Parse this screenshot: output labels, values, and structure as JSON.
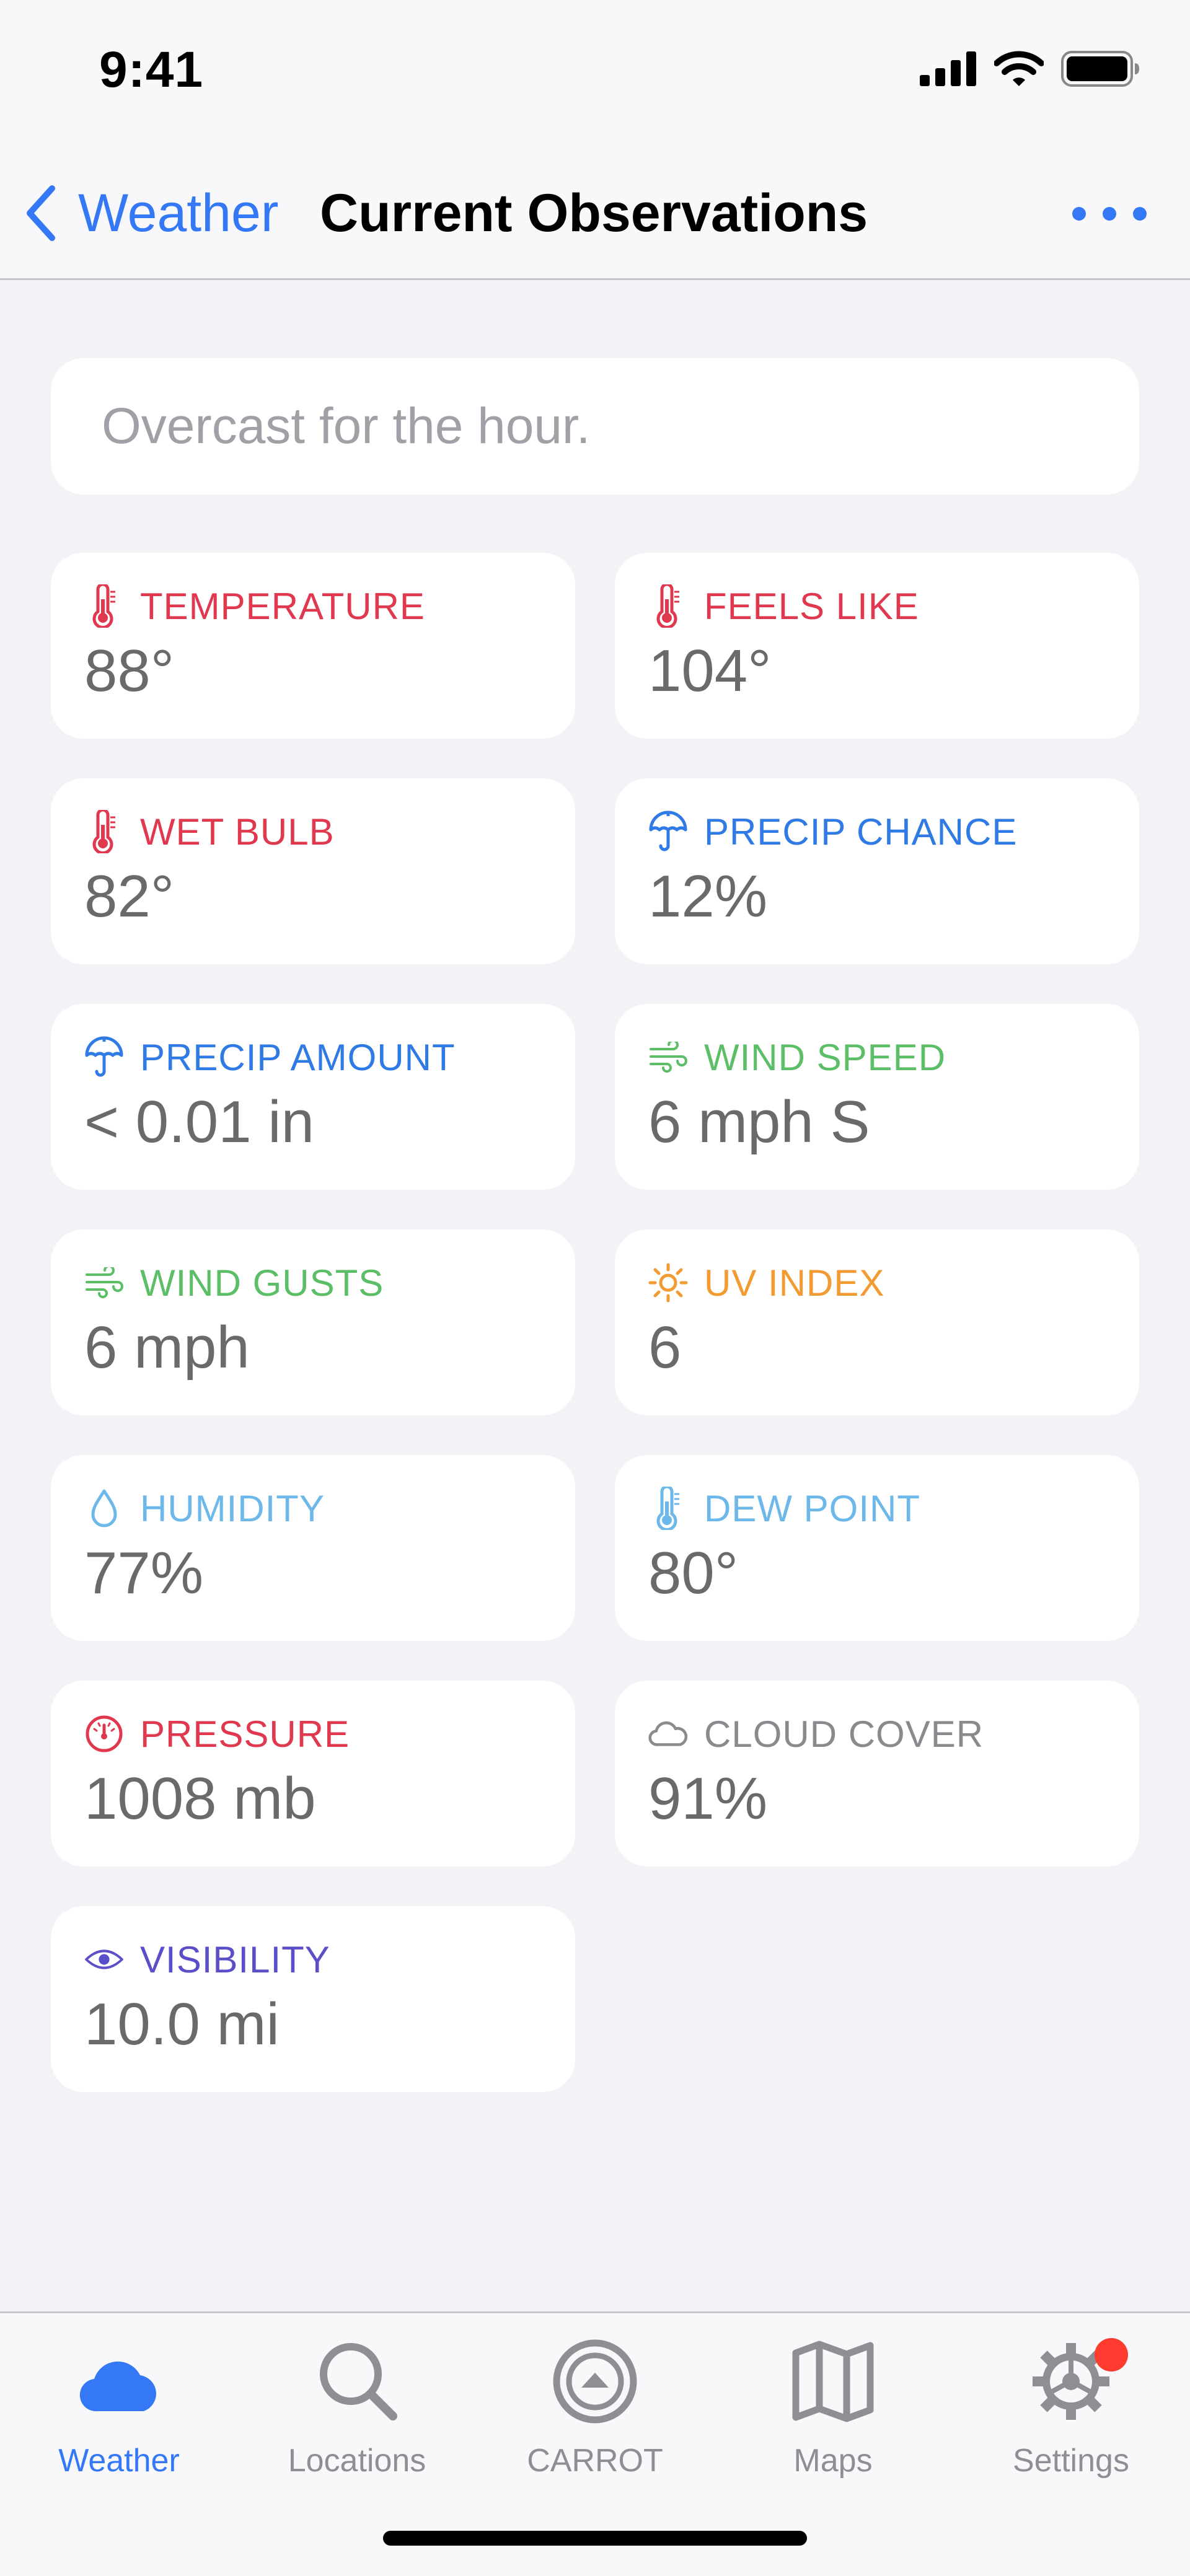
{
  "status_bar": {
    "time": "9:41"
  },
  "nav": {
    "back_label": "Weather",
    "title": "Current Observations"
  },
  "summary": {
    "text": "Overcast for the hour."
  },
  "tiles": [
    {
      "label": "TEMPERATURE",
      "value": "88°",
      "icon": "thermometer-icon",
      "color": "#e0384f"
    },
    {
      "label": "FEELS LIKE",
      "value": "104°",
      "icon": "thermometer-icon",
      "color": "#e0384f"
    },
    {
      "label": "WET BULB",
      "value": "82°",
      "icon": "thermometer-icon",
      "color": "#e0384f"
    },
    {
      "label": "PRECIP CHANCE",
      "value": "12%",
      "icon": "umbrella-icon",
      "color": "#2f7ae5"
    },
    {
      "label": "PRECIP AMOUNT",
      "value": "< 0.01 in",
      "icon": "umbrella-icon",
      "color": "#2f7ae5"
    },
    {
      "label": "WIND SPEED",
      "value": "6 mph S",
      "icon": "wind-icon",
      "color": "#5cbe66"
    },
    {
      "label": "WIND GUSTS",
      "value": "6 mph",
      "icon": "wind-icon",
      "color": "#5cbe66"
    },
    {
      "label": "UV INDEX",
      "value": "6",
      "icon": "sun-icon",
      "color": "#f29b33"
    },
    {
      "label": "HUMIDITY",
      "value": "77%",
      "icon": "droplet-icon",
      "color": "#6cb8ea"
    },
    {
      "label": "DEW POINT",
      "value": "80°",
      "icon": "thermometer-icon",
      "color": "#6cb8ea"
    },
    {
      "label": "PRESSURE",
      "value": "1008 mb",
      "icon": "gauge-icon",
      "color": "#e0384f"
    },
    {
      "label": "CLOUD COVER",
      "value": "91%",
      "icon": "cloud-icon",
      "color": "#8a8a8e"
    },
    {
      "label": "VISIBILITY",
      "value": "10.0 mi",
      "icon": "eye-icon",
      "color": "#5a4fc8"
    }
  ],
  "tabs": [
    {
      "label": "Weather",
      "icon": "cloud-icon",
      "active": true
    },
    {
      "label": "Locations",
      "icon": "magnifier-icon",
      "active": false
    },
    {
      "label": "CARROT",
      "icon": "carrot-icon",
      "active": false
    },
    {
      "label": "Maps",
      "icon": "map-icon",
      "active": false
    },
    {
      "label": "Settings",
      "icon": "gear-icon",
      "active": false
    }
  ],
  "colors": {
    "accent": "#3478f6",
    "tab_inactive": "#8e8e93",
    "badge": "#ff3b30",
    "background": "#f2f2f7"
  }
}
